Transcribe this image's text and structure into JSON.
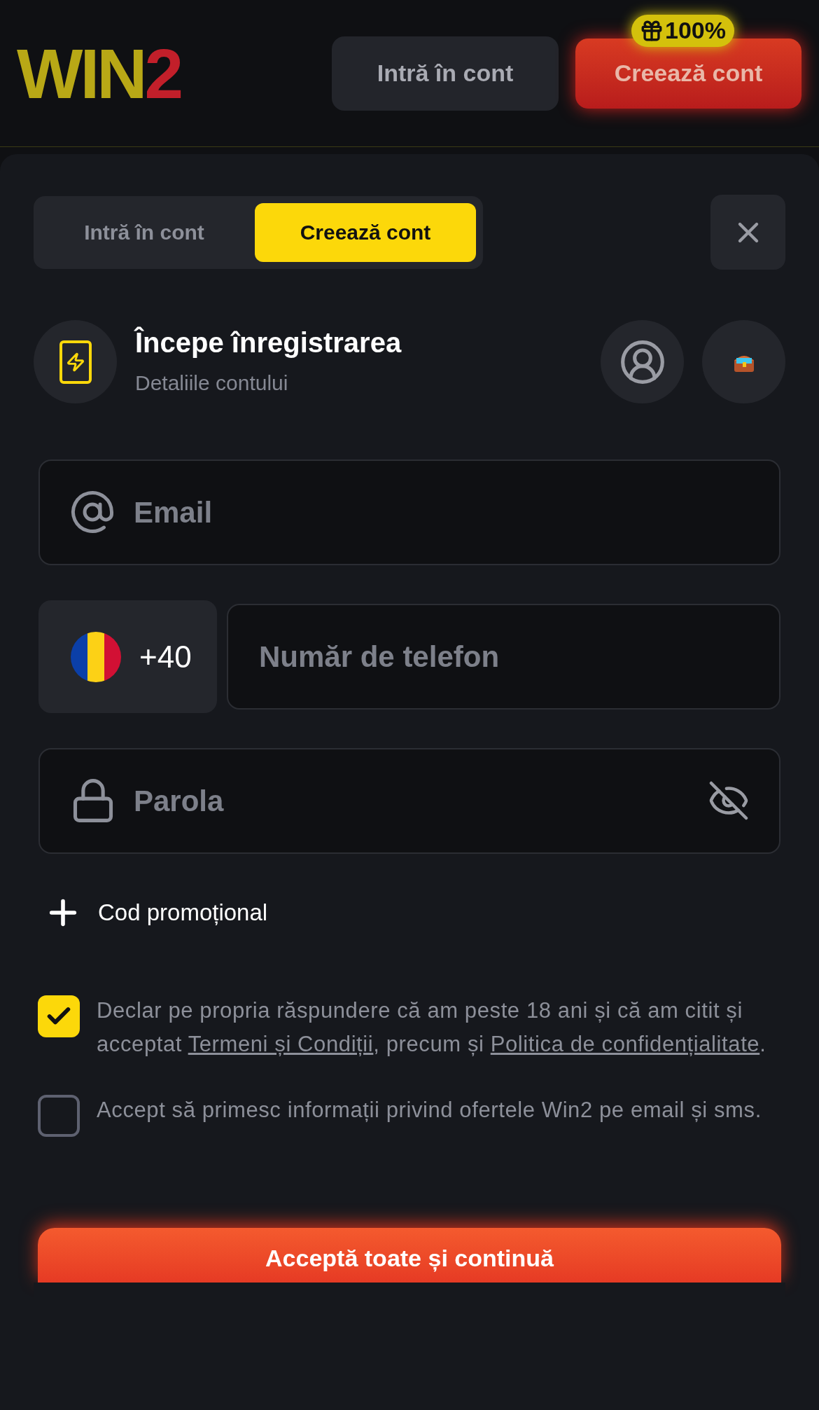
{
  "header": {
    "logo": {
      "text": "WIN",
      "accent": "2"
    },
    "buttons": [
      {
        "label": "Intră în cont",
        "kind": "secondary"
      },
      {
        "label": "Creează cont",
        "kind": "primary",
        "badge": "100%"
      }
    ]
  },
  "tabs": [
    {
      "label": "Intră în cont",
      "selected": false
    },
    {
      "label": "Creează cont",
      "selected": true
    }
  ],
  "step": {
    "title": "Începe înregistrarea",
    "subtitle": "Detaliile contului"
  },
  "form": {
    "email": {
      "placeholder": "Email"
    },
    "phone": {
      "country_code": "+40",
      "placeholder": "Număr de telefon"
    },
    "password": {
      "placeholder": "Parola"
    },
    "promo": {
      "label": "Cod promoțional"
    }
  },
  "consents": [
    {
      "checked": true,
      "parts": [
        {
          "text": "Declar pe propria răspundere că am peste 18 ani și că am citit și acceptat "
        },
        {
          "text": "Termeni și Condiții",
          "link": true
        },
        {
          "text": ", precum și "
        },
        {
          "text": "Politica de confidențialitate",
          "link": true
        },
        {
          "text": "."
        }
      ]
    },
    {
      "checked": false,
      "parts": [
        {
          "text": "Accept să primesc informații privind ofertele Win2 pe email și sms."
        }
      ]
    }
  ],
  "submit": {
    "label": "Acceptă toate și continuă"
  }
}
